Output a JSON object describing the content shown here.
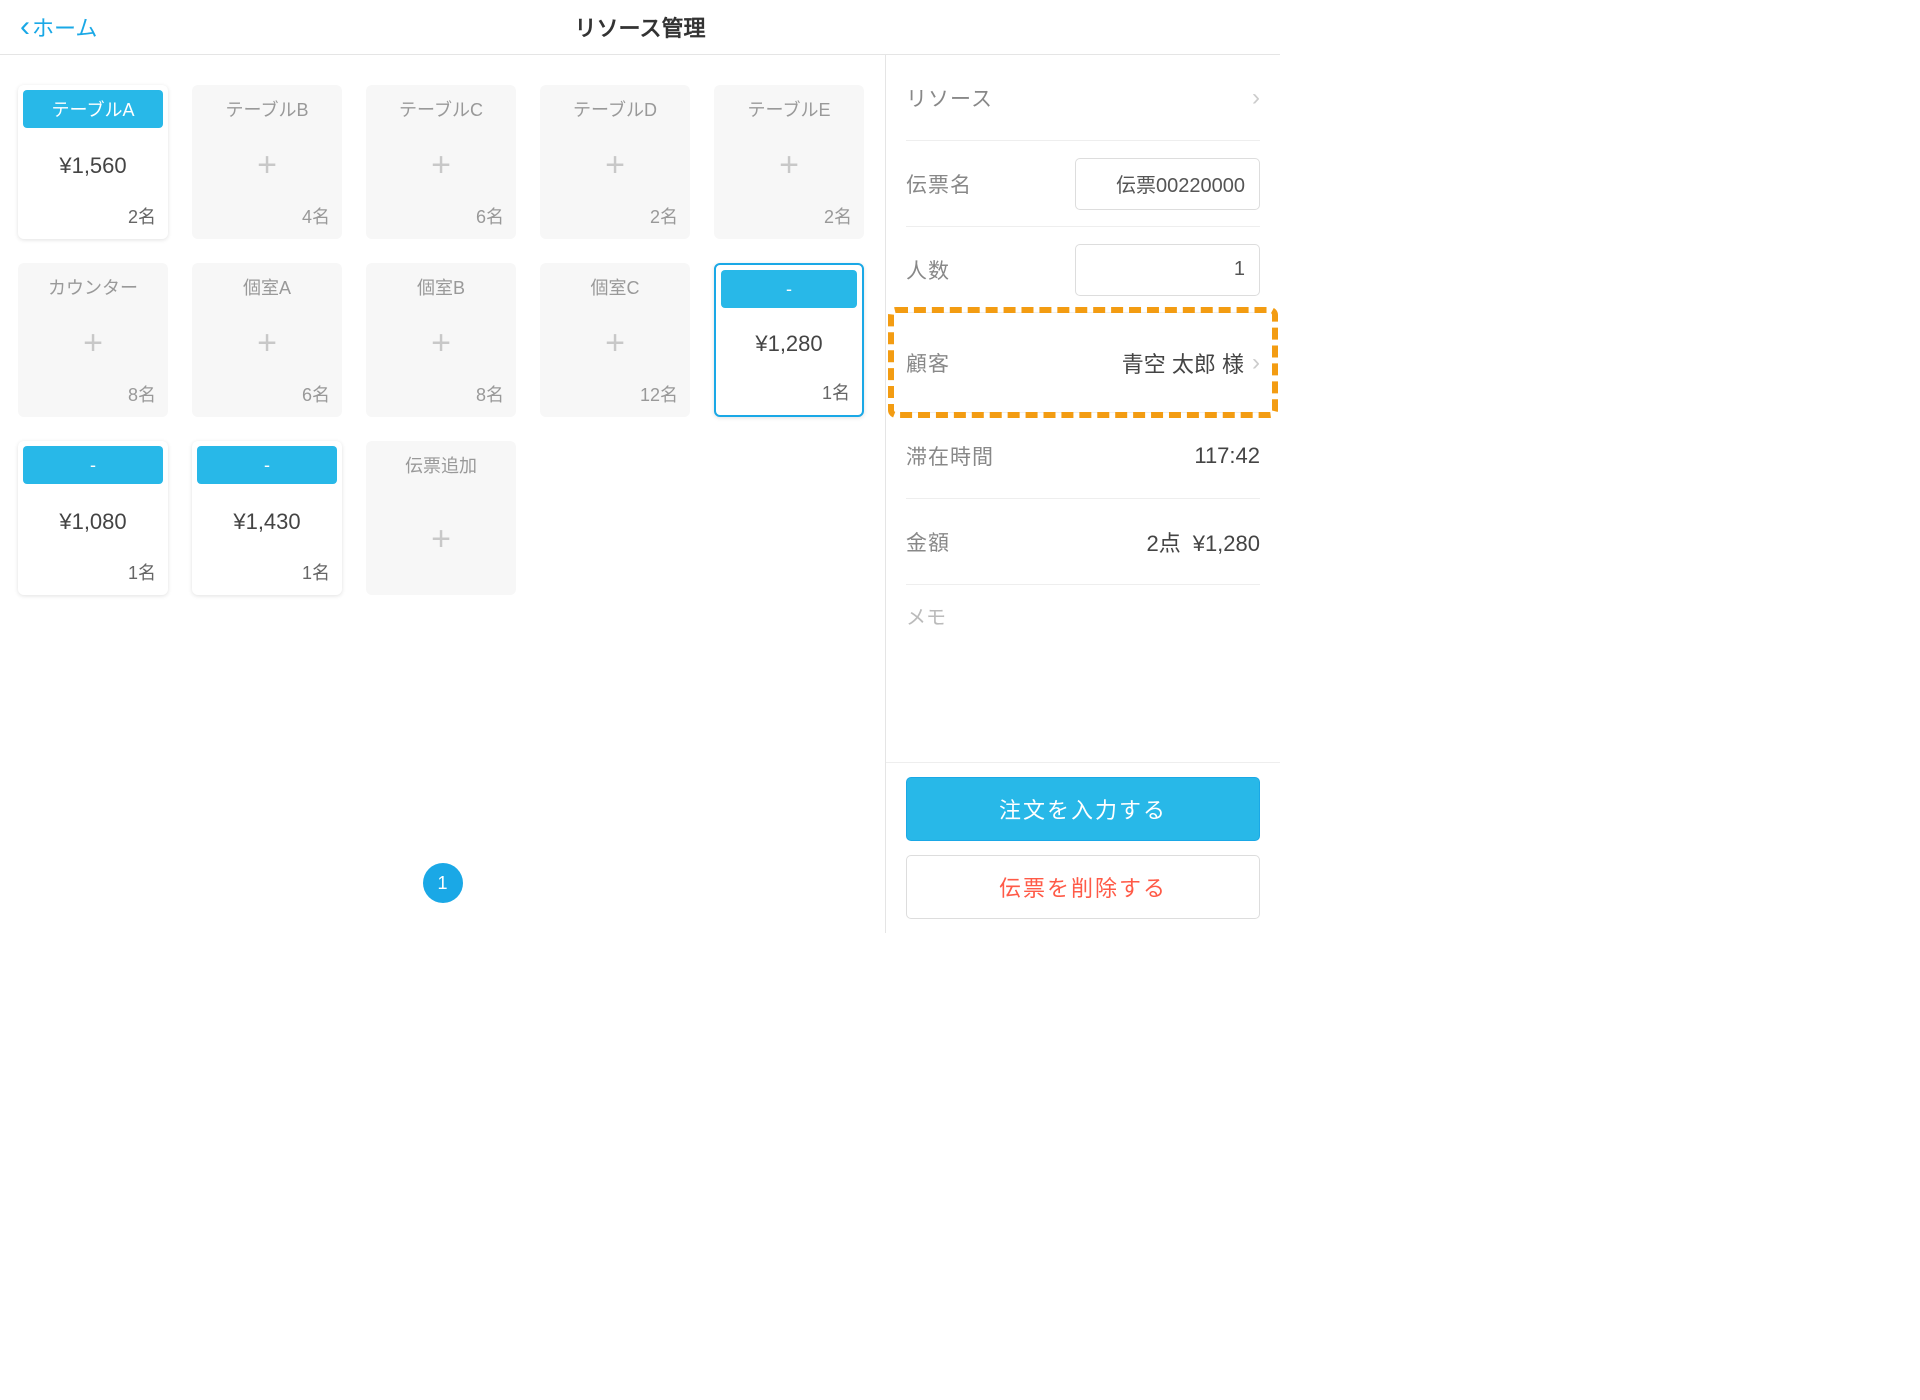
{
  "header": {
    "back_label": "ホーム",
    "title": "リソース管理"
  },
  "tables": [
    {
      "name": "テーブルA",
      "price": "¥1,560",
      "capacity": "2名",
      "state": "active",
      "header_style": "filled"
    },
    {
      "name": "テーブルB",
      "price": "",
      "capacity": "4名",
      "state": "empty",
      "header_style": "plain"
    },
    {
      "name": "テーブルC",
      "price": "",
      "capacity": "6名",
      "state": "empty",
      "header_style": "plain"
    },
    {
      "name": "テーブルD",
      "price": "",
      "capacity": "2名",
      "state": "empty",
      "header_style": "plain"
    },
    {
      "name": "テーブルE",
      "price": "",
      "capacity": "2名",
      "state": "empty",
      "header_style": "plain"
    },
    {
      "name": "カウンター",
      "price": "",
      "capacity": "8名",
      "state": "empty",
      "header_style": "plain"
    },
    {
      "name": "個室A",
      "price": "",
      "capacity": "6名",
      "state": "empty",
      "header_style": "plain"
    },
    {
      "name": "個室B",
      "price": "",
      "capacity": "8名",
      "state": "empty",
      "header_style": "plain"
    },
    {
      "name": "個室C",
      "price": "",
      "capacity": "12名",
      "state": "empty",
      "header_style": "plain"
    },
    {
      "name": "-",
      "price": "¥1,280",
      "capacity": "1名",
      "state": "selected",
      "header_style": "dash"
    },
    {
      "name": "-",
      "price": "¥1,080",
      "capacity": "1名",
      "state": "active",
      "header_style": "dash"
    },
    {
      "name": "-",
      "price": "¥1,430",
      "capacity": "1名",
      "state": "active",
      "header_style": "dash"
    },
    {
      "name": "伝票追加",
      "price": "",
      "capacity": "",
      "state": "addslip",
      "header_style": "plain"
    }
  ],
  "pagination": {
    "current": "1"
  },
  "sidebar": {
    "resource_label": "リソース",
    "slip_label": "伝票名",
    "slip_value": "伝票00220000",
    "people_label": "人数",
    "people_value": "1",
    "customer_label": "顧客",
    "customer_value": "青空 太郎 様",
    "stay_label": "滞在時間",
    "stay_value": "117:42",
    "amount_label": "金額",
    "amount_count": "2点",
    "amount_value": "¥1,280",
    "memo_placeholder": "メモ"
  },
  "actions": {
    "order_label": "注文を入力する",
    "delete_label": "伝票を削除する"
  }
}
